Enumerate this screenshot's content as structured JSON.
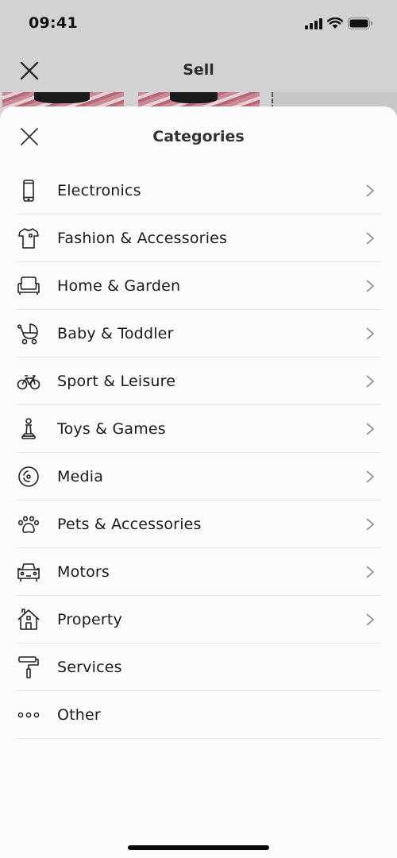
{
  "status_bar": {
    "time": "09:41",
    "icons": [
      "signal-icon",
      "wifi-icon",
      "battery-icon"
    ]
  },
  "nav": {
    "title": "Sell",
    "close_icon": "close-icon"
  },
  "sheet": {
    "title": "Categories",
    "close_icon": "close-icon",
    "items": [
      {
        "label": "Electronics",
        "icon": "phone-icon",
        "has_chevron": true
      },
      {
        "label": "Fashion & Accessories",
        "icon": "tshirt-icon",
        "has_chevron": true
      },
      {
        "label": "Home & Garden",
        "icon": "armchair-icon",
        "has_chevron": true
      },
      {
        "label": "Baby & Toddler",
        "icon": "pram-icon",
        "has_chevron": true
      },
      {
        "label": "Sport & Leisure",
        "icon": "bicycle-icon",
        "has_chevron": true
      },
      {
        "label": "Toys & Games",
        "icon": "game-pawn-icon",
        "has_chevron": true
      },
      {
        "label": "Media",
        "icon": "disc-icon",
        "has_chevron": true
      },
      {
        "label": "Pets & Accessories",
        "icon": "paw-icon",
        "has_chevron": true
      },
      {
        "label": "Motors",
        "icon": "car-icon",
        "has_chevron": true
      },
      {
        "label": "Property",
        "icon": "house-icon",
        "has_chevron": true
      },
      {
        "label": "Services",
        "icon": "paint-roller-icon",
        "has_chevron": false
      },
      {
        "label": "Other",
        "icon": "more-dots-icon",
        "has_chevron": false
      }
    ]
  },
  "colors": {
    "backdrop": "#d2d2d2",
    "sheet_bg": "#fdfcfd",
    "text": "#1a1a1a",
    "divider": "#e6e6e6",
    "chevron": "#8a8a8a"
  }
}
